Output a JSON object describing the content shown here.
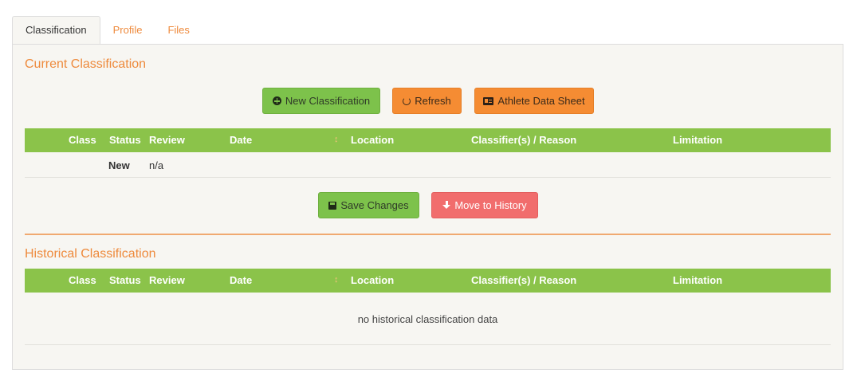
{
  "tabs": [
    {
      "label": "Classification",
      "active": true
    },
    {
      "label": "Profile",
      "active": false
    },
    {
      "label": "Files",
      "active": false
    }
  ],
  "current": {
    "title": "Current Classification",
    "buttons": {
      "new_classification": {
        "label": "New Classification",
        "icon": "plus-circle-icon"
      },
      "refresh": {
        "label": "Refresh",
        "icon": "refresh-icon"
      },
      "athlete_data_sheet": {
        "label": "Athlete Data Sheet",
        "icon": "id-card-icon"
      }
    },
    "row": {
      "class": "",
      "status": "New",
      "review": "n/a",
      "date": "",
      "location": "",
      "classifiers": "",
      "limitation": ""
    },
    "save_changes": {
      "label": "Save Changes",
      "icon": "save-icon"
    },
    "move_to_history": {
      "label": "Move to History",
      "icon": "arrow-down-icon"
    }
  },
  "historical": {
    "title": "Historical Classification",
    "empty_message": "no historical classification data"
  },
  "columns": {
    "class": "Class",
    "status": "Status",
    "review": "Review",
    "date": "Date",
    "location": "Location",
    "classifiers": "Classifier(s) / Reason",
    "limitation": "Limitation"
  },
  "colors": {
    "accent_orange": "#ee8a3c",
    "header_green": "#8bc34a",
    "button_green": "#7dc24b",
    "button_orange": "#f58c33",
    "button_red": "#f16d6d",
    "panel_bg": "#f7f6f2"
  }
}
